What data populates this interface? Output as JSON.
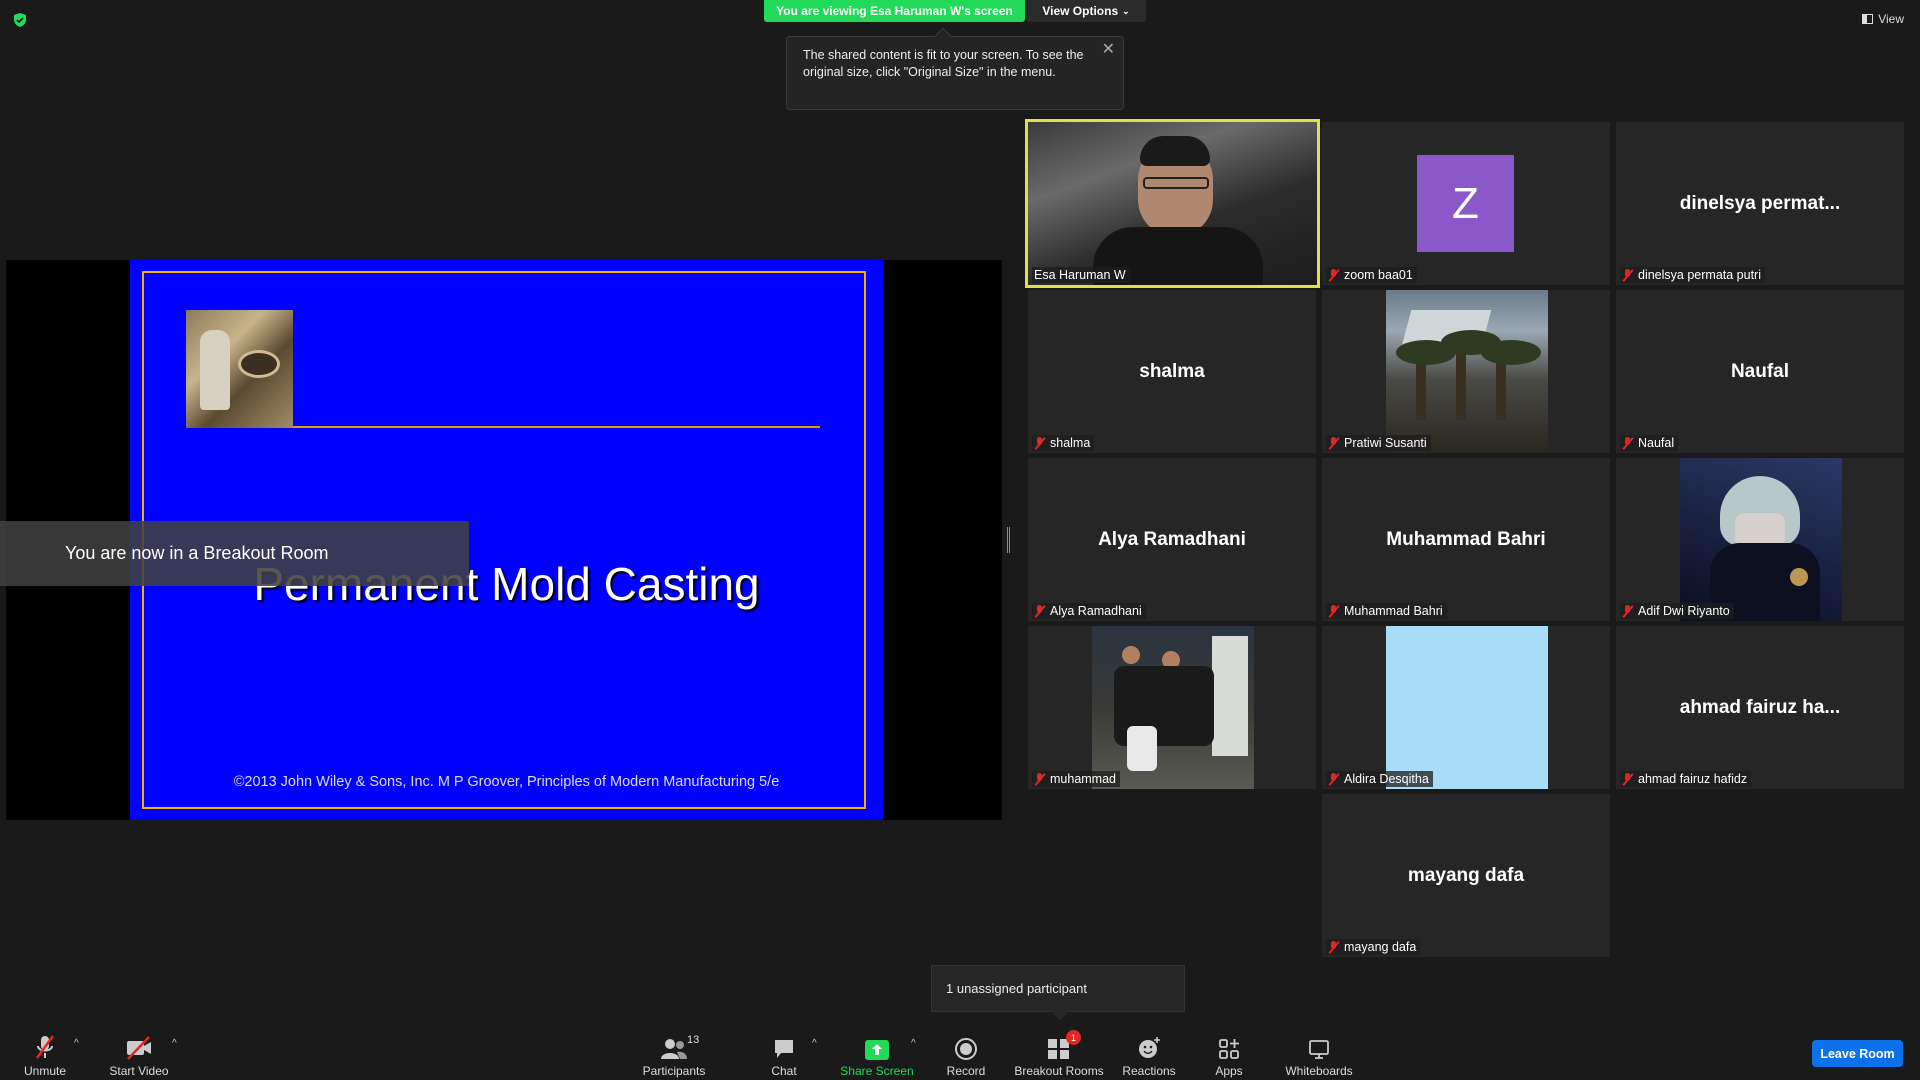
{
  "top": {
    "viewing_banner": "You are viewing Esa Haruman W's screen",
    "view_options": "View Options",
    "view": "View"
  },
  "tooltip": {
    "text": "The shared content is fit to your screen. To see the original size, click \"Original Size\" in the menu.",
    "close": "✕"
  },
  "slide": {
    "title": "Permanent Mold Casting",
    "footer": "©2013 John Wiley & Sons, Inc.  M P Groover, Principles of Modern Manufacturing 5/e"
  },
  "breakout_notice": "You are now in a Breakout Room",
  "gallery": {
    "tiles": [
      {
        "name": "Esa Haruman W",
        "display": "",
        "muted": false,
        "active": true,
        "kind": "video-person"
      },
      {
        "name": "zoom baa01",
        "display": "Z",
        "muted": true,
        "kind": "avatar"
      },
      {
        "name": "dinelsya permata putri",
        "display": "dinelsya permat...",
        "muted": true,
        "kind": "name"
      },
      {
        "name": "shalma",
        "display": "shalma",
        "muted": true,
        "kind": "name"
      },
      {
        "name": "Pratiwi Susanti",
        "display": "",
        "muted": true,
        "kind": "photo-resort"
      },
      {
        "name": "Naufal",
        "display": "Naufal",
        "muted": true,
        "kind": "name"
      },
      {
        "name": "Alya Ramadhani",
        "display": "Alya Ramadhani",
        "muted": true,
        "kind": "name"
      },
      {
        "name": "Muhammad Bahri",
        "display": "Muhammad Bahri",
        "muted": true,
        "kind": "name"
      },
      {
        "name": "Adif Dwi Riyanto",
        "display": "",
        "muted": true,
        "kind": "photo-anime"
      },
      {
        "name": "muhammad",
        "display": "",
        "muted": true,
        "kind": "photo-group"
      },
      {
        "name": "Aldira Desqitha",
        "display": "",
        "muted": true,
        "kind": "photo-blue"
      },
      {
        "name": "ahmad fairuz hafidz",
        "display": "ahmad fairuz ha...",
        "muted": true,
        "kind": "name"
      },
      {
        "name": "mayang dafa",
        "display": "mayang dafa",
        "muted": true,
        "kind": "name"
      }
    ]
  },
  "unassigned": "1 unassigned participant",
  "toolbar": {
    "unmute": "Unmute",
    "start_video": "Start Video",
    "participants": "Participants",
    "participants_count": "13",
    "chat": "Chat",
    "share_screen": "Share Screen",
    "record": "Record",
    "breakout_rooms": "Breakout Rooms",
    "breakout_badge": "1",
    "reactions": "Reactions",
    "apps": "Apps",
    "whiteboards": "Whiteboards",
    "leave": "Leave Room"
  },
  "colors": {
    "banner_green": "#23d959",
    "slide_blue": "#0000ff",
    "slide_border": "#f0b400",
    "leave_blue": "#0e71eb",
    "active_speaker": "#dfe04c",
    "muted_red": "#e02828"
  }
}
